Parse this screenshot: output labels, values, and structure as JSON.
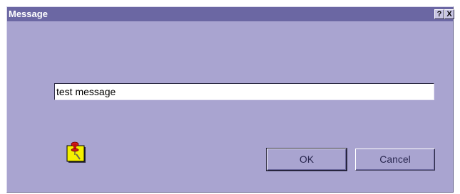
{
  "window": {
    "title": "Message",
    "help_label": "?",
    "close_label": "X"
  },
  "input": {
    "value": "test message"
  },
  "icon": {
    "name": "pushpin-note-icon"
  },
  "buttons": {
    "ok_label": "OK",
    "cancel_label": "Cancel"
  },
  "colors": {
    "window_bg": "#a9a4d0",
    "titlebar_bg": "#6b67a3",
    "title_text": "#ffffff",
    "note_yellow": "#f5f000",
    "pin_red": "#d01818"
  }
}
